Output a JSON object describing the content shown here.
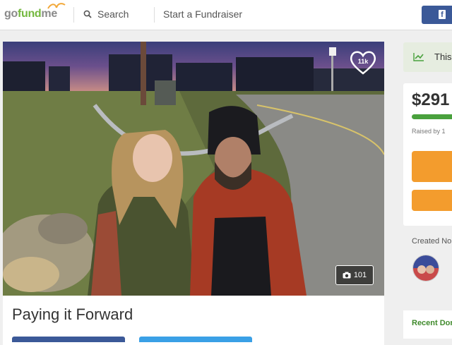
{
  "header": {
    "logo_go": "go",
    "logo_fund": "fund",
    "logo_me": "me",
    "search_label": "Search",
    "start_label": "Start a Fundraiser",
    "fb_label": "f"
  },
  "campaign": {
    "title": "Paying it Forward",
    "heart_count": "11k",
    "photo_count": "101"
  },
  "sidebar": {
    "banner_text": "This",
    "amount": "$291",
    "progress": 1.0,
    "raised_text": "Raised by 1",
    "created_text": "Created No",
    "recent_text": "Recent Don"
  },
  "colors": {
    "brand_green": "#74b83f",
    "donate_orange": "#f39c2d",
    "facebook_blue": "#3b5998"
  }
}
